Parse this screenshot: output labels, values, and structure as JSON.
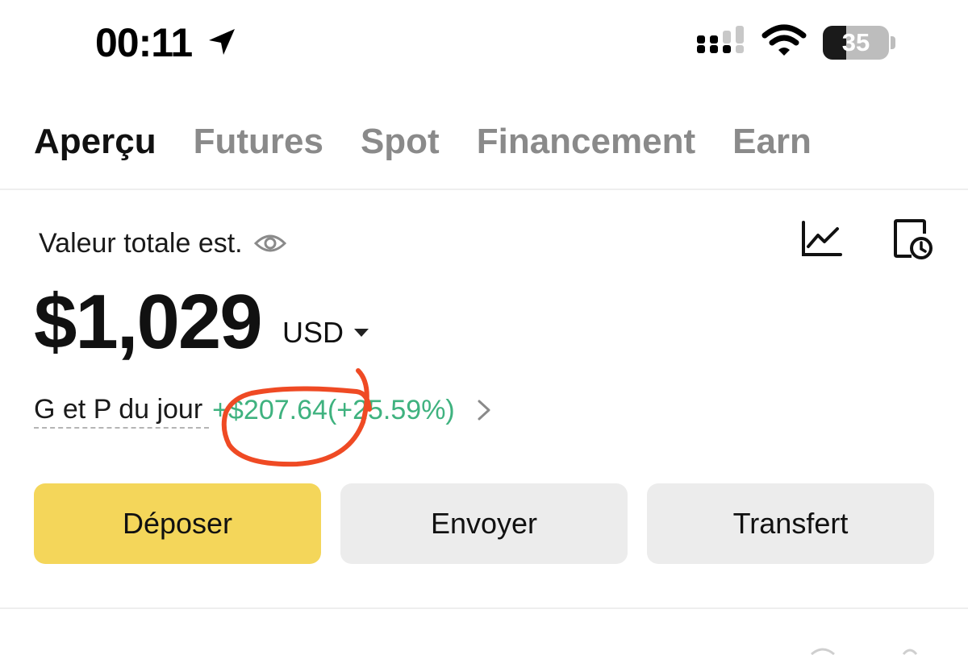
{
  "status_bar": {
    "time": "00:11",
    "battery_level": "35",
    "battery_fraction": 0.35
  },
  "tabs": [
    {
      "label": "Aperçu",
      "active": true
    },
    {
      "label": "Futures",
      "active": false
    },
    {
      "label": "Spot",
      "active": false
    },
    {
      "label": "Financement",
      "active": false
    },
    {
      "label": "Earn",
      "active": false
    }
  ],
  "overview": {
    "total_label": "Valeur totale est.",
    "amount": "$1,029",
    "currency": "USD",
    "pnl_label": "G et P du jour",
    "pnl_value": "+$207.64",
    "pnl_percent": "(+25.59%)"
  },
  "actions": {
    "deposit_label": "Déposer",
    "send_label": "Envoyer",
    "transfer_label": "Transfert"
  },
  "colors": {
    "accent_yellow": "#f4d65a",
    "profit_green": "#3fb27f",
    "annotation_red": "#ef4a24",
    "secondary_button": "#ececec"
  },
  "icons": [
    "location-arrow-icon",
    "cellular-signal-icon",
    "wifi-icon",
    "battery-icon",
    "eye-icon",
    "line-chart-icon",
    "history-icon",
    "caret-down-icon",
    "chevron-right-icon"
  ]
}
